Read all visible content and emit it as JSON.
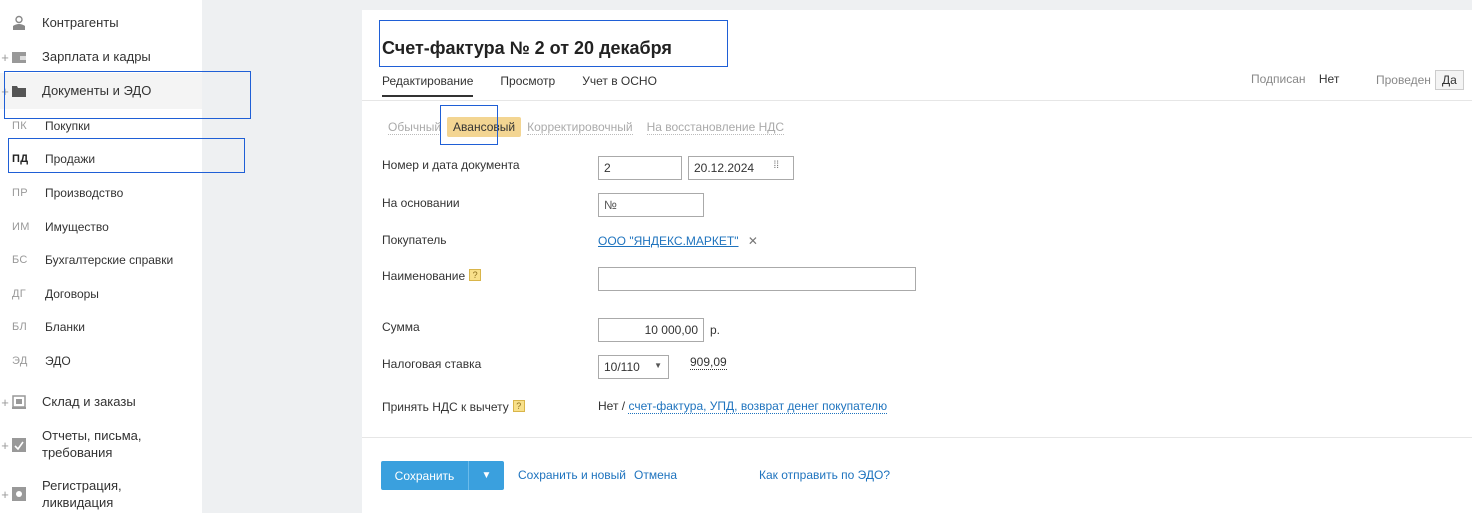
{
  "sidebar": {
    "top_items": [
      {
        "label": "Контрагенты",
        "icon": "contacts-icon",
        "expander": ""
      },
      {
        "label": "Зарплата и кадры",
        "icon": "wallet-icon",
        "expander": "+"
      },
      {
        "label": "Документы и ЭДО",
        "icon": "folder-icon",
        "expander": "+"
      }
    ],
    "sub_items": [
      {
        "abbr": "ПК",
        "label": "Покупки"
      },
      {
        "abbr": "ПД",
        "label": "Продажи"
      },
      {
        "abbr": "ПР",
        "label": "Производство"
      },
      {
        "abbr": "ИМ",
        "label": "Имущество"
      },
      {
        "abbr": "БС",
        "label": "Бухгалтерские справки"
      },
      {
        "abbr": "ДГ",
        "label": "Договоры"
      },
      {
        "abbr": "БЛ",
        "label": "Бланки"
      },
      {
        "abbr": "ЭД",
        "label": "ЭДО"
      }
    ],
    "bottom_items": [
      {
        "label": "Склад и заказы",
        "icon": "warehouse-icon",
        "expander": "+"
      },
      {
        "label": "Отчеты, письма,",
        "label2": "требования",
        "icon": "report-icon",
        "expander": "+"
      },
      {
        "label": "Регистрация,",
        "label2": "ликвидация",
        "icon": "registration-icon",
        "expander": "+"
      }
    ]
  },
  "document": {
    "title": "Счет-фактура № 2 от 20 декабря",
    "tabs": [
      "Редактирование",
      "Просмотр",
      "Учет в ОСНО"
    ],
    "status": {
      "signed_label": "Подписан",
      "signed_value": "Нет",
      "posted_label": "Проведен",
      "posted_value": "Да"
    },
    "types": [
      "Обычный",
      "Авансовый",
      "Корректировочный",
      "На восстановление НДС"
    ],
    "fields": {
      "number_date_label": "Номер и дата документа",
      "number": "2",
      "date": "20.12.2024",
      "basis_label": "На основании",
      "basis_value": "№",
      "buyer_label": "Покупатель",
      "buyer_value": "ООО \"ЯНДЕКС.МАРКЕТ\"",
      "buyer_remove": "✕",
      "name_label": "Наименование",
      "name_value": "",
      "hint_glyph": "?",
      "sum_label": "Сумма",
      "sum_value": "10 000,00",
      "sum_currency": "р.",
      "tax_label": "Налоговая ставка",
      "tax_value": "10/110",
      "tax_amount": "909,09",
      "vat_label": "Принять НДС к вычету",
      "vat_value": "Нет /",
      "vat_link": "счет-фактура, УПД, возврат денег покупателю"
    },
    "footer": {
      "save": "Сохранить",
      "save_new": "Сохранить и новый",
      "cancel": "Отмена",
      "edo_link": "Как отправить по ЭДО?"
    }
  }
}
